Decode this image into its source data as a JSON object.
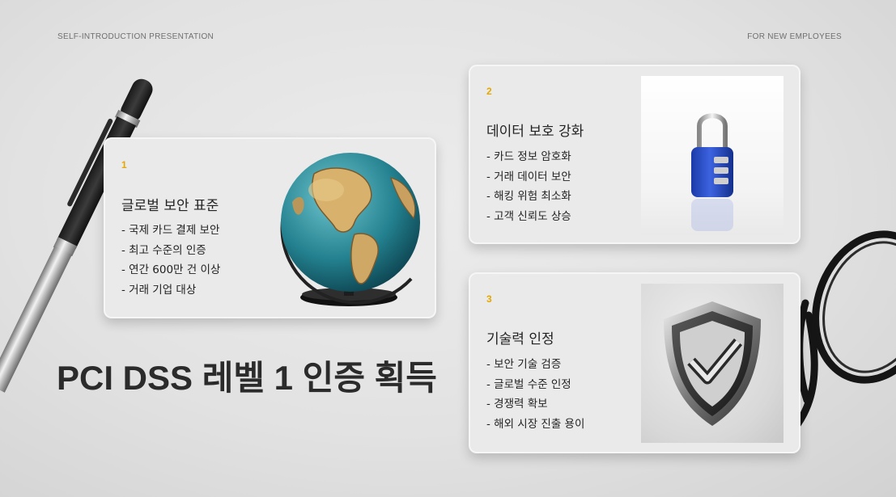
{
  "header": {
    "left_label": "SELF-INTRODUCTION PRESENTATION",
    "right_label": "FOR NEW EMPLOYEES"
  },
  "heading": "PCI DSS 레벨 1 인증 획득",
  "colors": {
    "accent": "#e5a800",
    "text": "#222222",
    "card": "#eaeaea"
  },
  "cards": [
    {
      "number": "1",
      "title": "글로벌 보안 표준",
      "bullets": [
        "- 국제 카드 결제 보안",
        "- 최고 수준의 인증",
        "- 연간 600만 건 이상",
        "- 거래 기업 대상"
      ],
      "image_icon": "globe-icon"
    },
    {
      "number": "2",
      "title": "데이터 보호 강화",
      "bullets": [
        "- 카드 정보 암호화",
        "- 거래 데이터 보안",
        "- 해킹 위험 최소화",
        "- 고객 신뢰도 상승"
      ],
      "image_icon": "padlock-icon"
    },
    {
      "number": "3",
      "title": "기술력 인정",
      "bullets": [
        "- 보안 기술 검증",
        "- 글로벌 수준 인정",
        "- 경쟁력 확보",
        "- 해외 시장 진출 용이"
      ],
      "image_icon": "shield-check-icon"
    }
  ],
  "decorations": [
    "pen-icon",
    "glasses-icon"
  ]
}
